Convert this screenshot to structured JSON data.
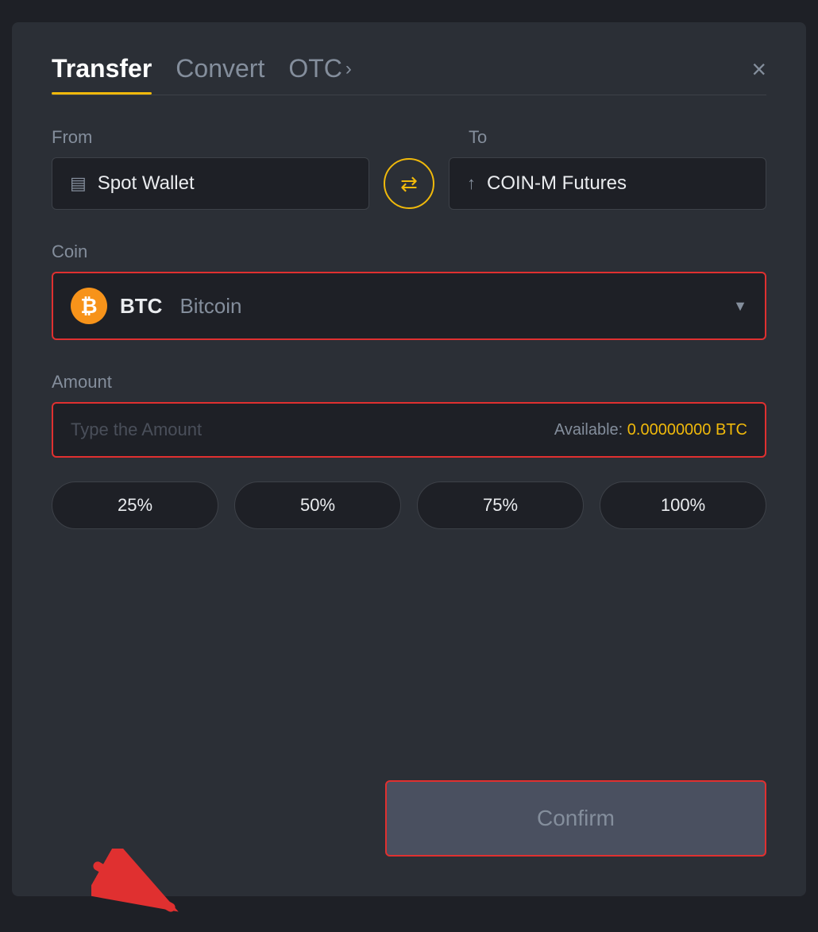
{
  "modal": {
    "tabs": [
      {
        "id": "transfer",
        "label": "Transfer",
        "active": true
      },
      {
        "id": "convert",
        "label": "Convert",
        "active": false
      },
      {
        "id": "otc",
        "label": "OTC",
        "active": false
      }
    ],
    "close_label": "×",
    "from_label": "From",
    "to_label": "To",
    "from_wallet": "Spot Wallet",
    "to_wallet": "COIN-M Futures",
    "swap_icon": "⇄",
    "coin_label": "Coin",
    "coin_symbol": "BTC",
    "coin_name": "Bitcoin",
    "amount_label": "Amount",
    "amount_placeholder": "Type the Amount",
    "available_label": "Available:",
    "available_amount": "0.00000000 BTC",
    "percent_buttons": [
      "25%",
      "50%",
      "75%",
      "100%"
    ],
    "confirm_label": "Confirm"
  }
}
